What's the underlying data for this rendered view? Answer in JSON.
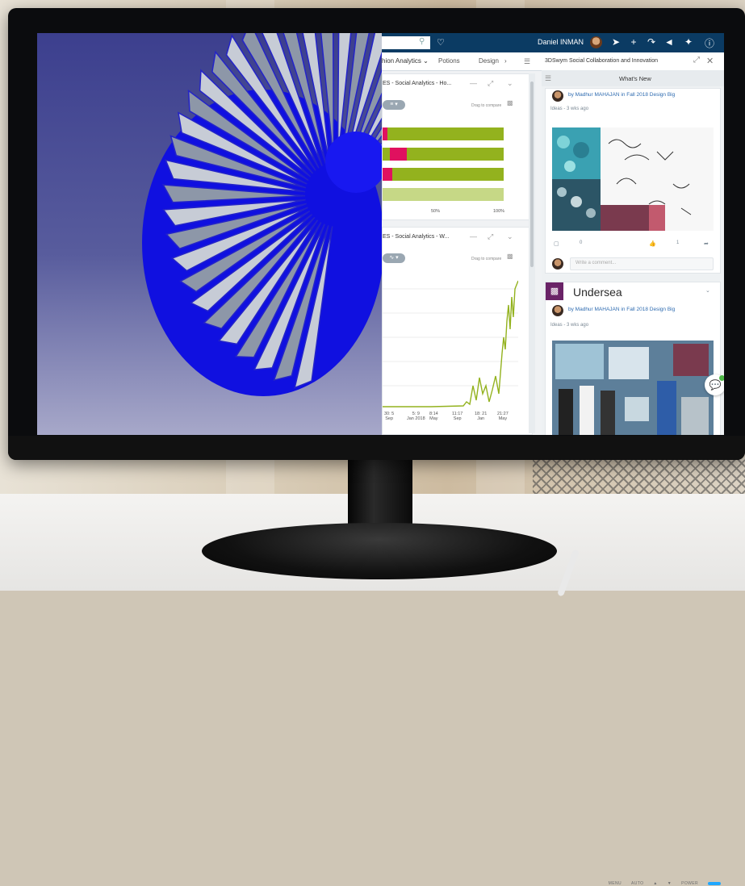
{
  "topbar": {
    "user_name": "Daniel INMAN",
    "icons": [
      "search-icon",
      "tag-icon",
      "compass-icon",
      "plus-icon",
      "share-icon",
      "network-icon",
      "tools-icon",
      "help-icon"
    ]
  },
  "tabs": [
    {
      "label": "hion Analytics ⌄"
    },
    {
      "label": "Potions"
    },
    {
      "label": "Design"
    },
    {
      "label": "›"
    }
  ],
  "side_panel": {
    "title": "3DSwym Social Collaboration and Innovation",
    "header": "What's New"
  },
  "widgets": [
    {
      "title": "ES - Social Analytics - Ho...",
      "drag_hint": "Drag to compare",
      "axis": [
        "50%",
        "100%"
      ],
      "bars": [
        {
          "pink_start": 0.0,
          "pink": 0.04,
          "green": 1.0
        },
        {
          "pink_start": 0.06,
          "pink": 0.14,
          "green": 1.0
        },
        {
          "pink_start": 0.0,
          "pink": 0.08,
          "green": 1.0
        },
        {
          "pink_start": 0.0,
          "pink": 0.0,
          "green": 1.0,
          "faded": true
        }
      ]
    },
    {
      "title": "ES - Social Analytics - W...",
      "drag_hint": "Drag to compare",
      "xticks": [
        "30: 5\nSep",
        "5: 9\nJan 2018",
        "8:14\nMay",
        "11:17\nSep",
        "18: 21\nJan",
        "21:27\nMay"
      ]
    }
  ],
  "feed": {
    "cards": [
      {
        "by": "by Madhur MAHAJAN in Fall 2018 Design Big",
        "meta": "Ideas - 3 wks ago",
        "comments": "0",
        "likes": "1",
        "comment_placeholder": "Write a comment..."
      },
      {
        "title": "Undersea",
        "by": "by Madhur MAHAJAN in Fall 2018 Design Big",
        "meta": "Ideas - 3 wks ago"
      }
    ]
  },
  "bezel": {
    "labels": [
      "MENU",
      "AUTO",
      "▲",
      "▼",
      "POWER"
    ]
  },
  "colors": {
    "topbar": "#0b3b63",
    "bar_green": "#93b21e",
    "bar_pink": "#e0115f",
    "cad_background": "#3c3f8e",
    "fan_blue": "#1010e0"
  }
}
